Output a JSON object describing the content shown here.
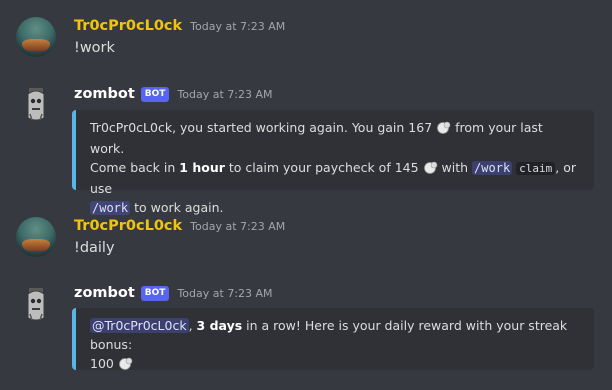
{
  "messages": [
    {
      "author": "Tr0cPr0cL0ck",
      "timestamp": "Today at 7:23 AM",
      "text": "!work"
    },
    {
      "author": "zombot",
      "badge": "BOT",
      "timestamp": "Today at 7:23 AM",
      "embed": {
        "line1_a": "Tr0cPr0cL0ck, you started working again. You gain 167",
        "line1_b": "from your last work.",
        "line2_a": "Come back in",
        "line2_bold": "1 hour",
        "line2_b": "to claim your paycheck of 145",
        "line2_c": "with",
        "cmd1": "/work",
        "code1": "claim",
        "line2_d": ", or use",
        "cmd2": "/work",
        "line3": "to work again."
      }
    },
    {
      "author": "Tr0cPr0cL0ck",
      "timestamp": "Today at 7:23 AM",
      "text": "!daily"
    },
    {
      "author": "zombot",
      "badge": "BOT",
      "timestamp": "Today at 7:23 AM",
      "embed": {
        "mention": "@Tr0cPr0cL0ck",
        "sep": ",",
        "bold": "3 days",
        "rest": "in a row! Here is your daily reward with your streak bonus:",
        "amount": "100"
      }
    }
  ],
  "colors": {
    "background": "#36393f",
    "user_name": "#f1c40f",
    "bot_badge": "#5865f2",
    "embed_border": "#59b5e6",
    "embed_bg": "#2f3136"
  },
  "icons": {
    "coin": "coin-icon",
    "user_avatar": "user-avatar",
    "bot_avatar": "zombie-avatar"
  }
}
